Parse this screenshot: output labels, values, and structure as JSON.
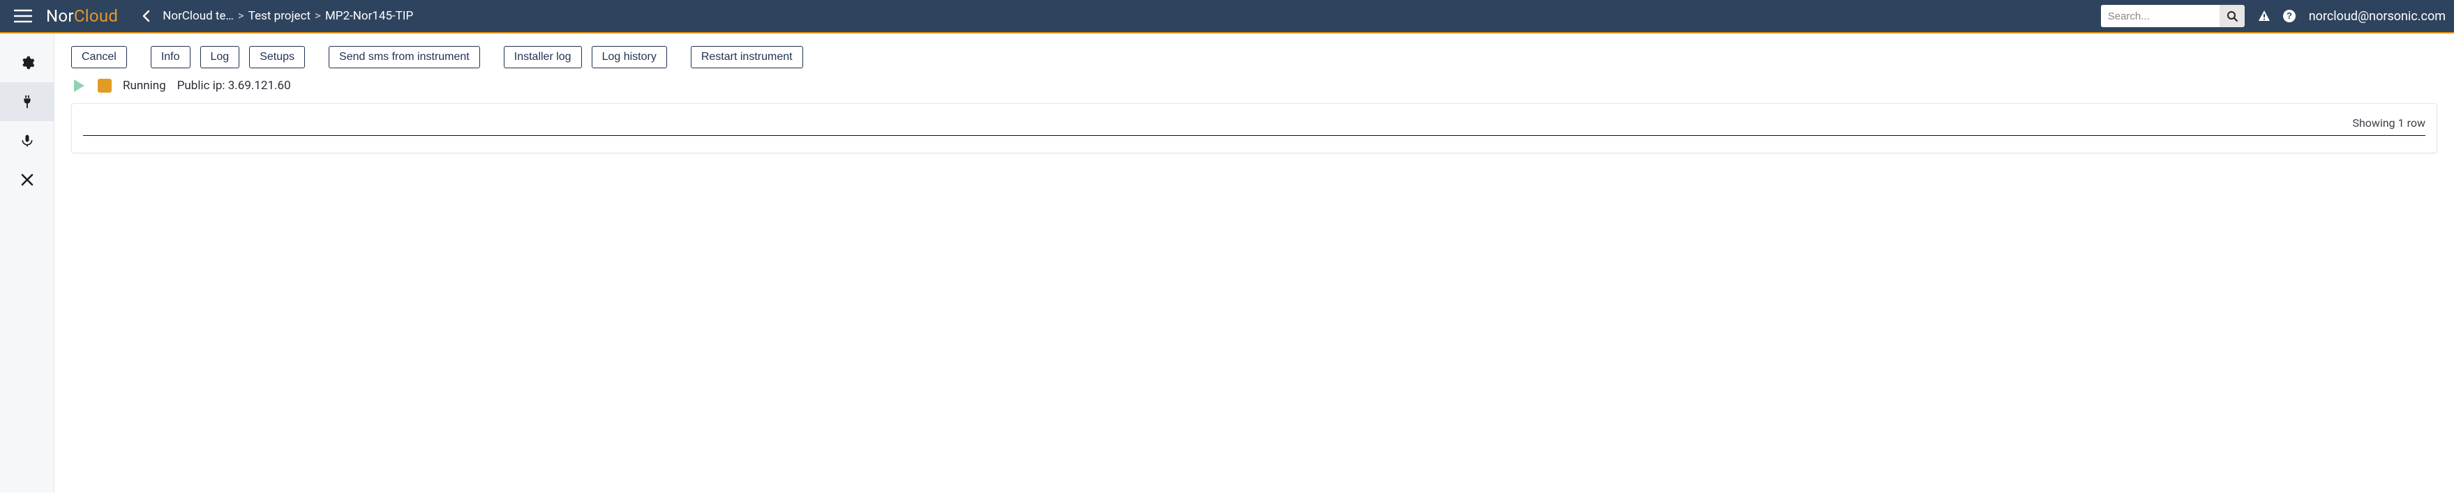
{
  "header": {
    "logo_part1": "Nor",
    "logo_part2": "Cloud",
    "breadcrumb": {
      "items": [
        {
          "label": "NorCloud te…"
        },
        {
          "label": "Test project"
        },
        {
          "label": "MP2-Nor145-TIP"
        }
      ],
      "sep": ">"
    },
    "search_placeholder": "Search...",
    "user_email": "norcloud@norsonic.com"
  },
  "sidebar": {
    "items": [
      {
        "icon": "gear-icon",
        "active": false
      },
      {
        "icon": "plug-icon",
        "active": true
      },
      {
        "icon": "mic-icon",
        "active": false
      },
      {
        "icon": "close-icon",
        "active": false
      }
    ]
  },
  "toolbar": {
    "cancel": "Cancel",
    "info": "Info",
    "log": "Log",
    "setups": "Setups",
    "send_sms": "Send sms from instrument",
    "installer_log": "Installer log",
    "log_history": "Log history",
    "restart": "Restart instrument"
  },
  "status": {
    "state_label": "Running",
    "ip_label": "Public ip: 3.69.121.60"
  },
  "card": {
    "rows_text": "Showing 1 row"
  }
}
